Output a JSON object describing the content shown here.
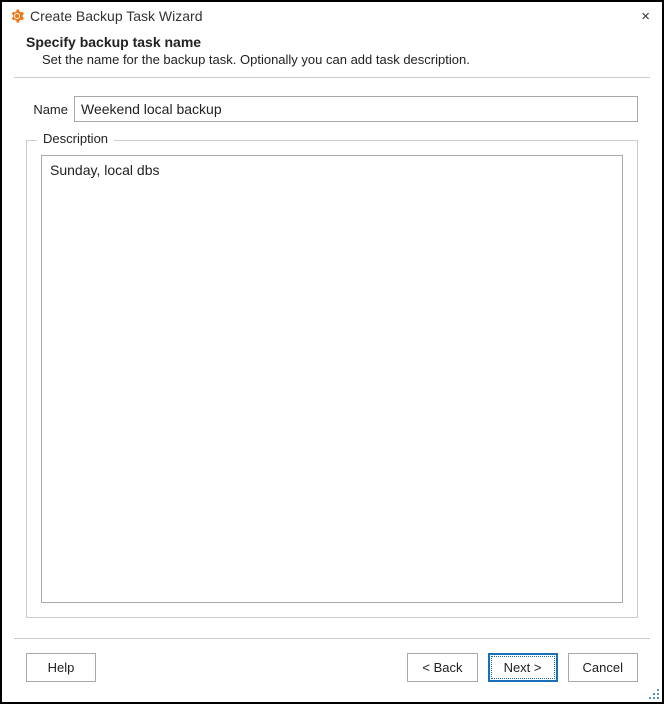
{
  "titlebar": {
    "title": "Create Backup Task Wizard",
    "close_label": "×"
  },
  "header": {
    "title": "Specify backup task name",
    "subtitle": "Set the name for the backup task. Optionally you can add task description."
  },
  "form": {
    "name_label": "Name",
    "name_value": "Weekend local backup",
    "description_legend": "Description",
    "description_value": "Sunday, local dbs"
  },
  "footer": {
    "help": "Help",
    "back": "< Back",
    "next": "Next >",
    "cancel": "Cancel"
  },
  "colors": {
    "accent": "#1a6fb8",
    "icon_orange": "#e87b1c"
  }
}
